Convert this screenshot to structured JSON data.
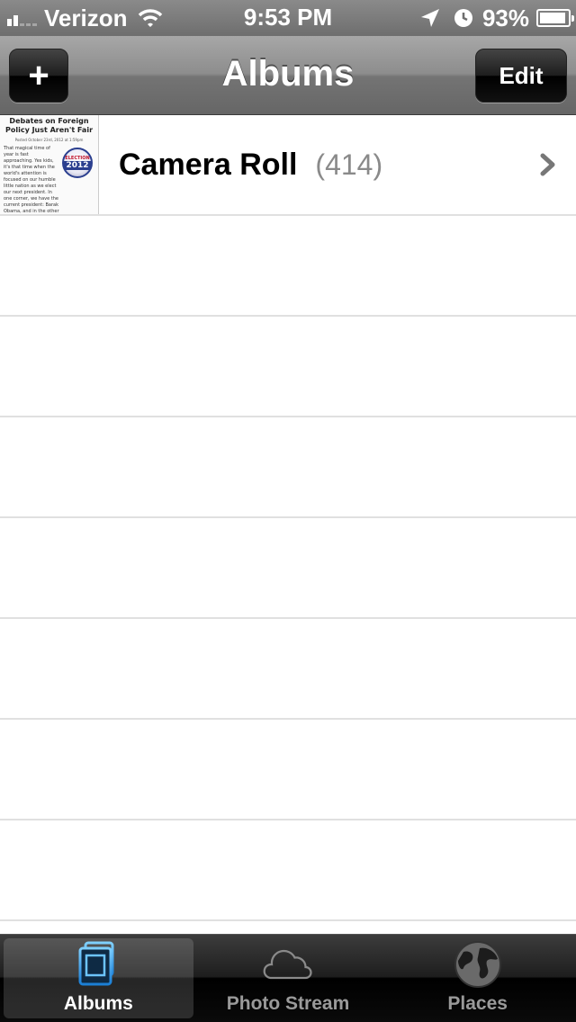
{
  "status_bar": {
    "carrier": "Verizon",
    "time": "9:53 PM",
    "battery_percent": "93%",
    "battery_level": 0.93
  },
  "nav_bar": {
    "title": "Albums",
    "add_label": "+",
    "edit_label": "Edit"
  },
  "albums": [
    {
      "name": "Camera Roll",
      "count": "(414)",
      "thumbnail": {
        "title": "Debates on Foreign Policy Just Aren't Fair",
        "meta": "Posted October 23rd, 2012 at 1:59pm",
        "body": "That magical time of year is fast approaching. Yes kids, it's that time when the world's attention is focused on our humble little nation as we elect our next president. In one corner, we have the current president: Barak Obama, and in the other corner, his challenger: Gov. Mitt Romney. It's gonna be a fight for the",
        "badge_top": "ELECTION",
        "badge_year": "2012"
      }
    }
  ],
  "tab_bar": {
    "tabs": [
      {
        "label": "Albums",
        "icon": "albums-icon",
        "active": true
      },
      {
        "label": "Photo Stream",
        "icon": "cloud-icon",
        "active": false
      },
      {
        "label": "Places",
        "icon": "globe-icon",
        "active": false
      }
    ]
  },
  "colors": {
    "accent_blue": "#3fa9f5",
    "count_gray": "#8a8a8a"
  }
}
